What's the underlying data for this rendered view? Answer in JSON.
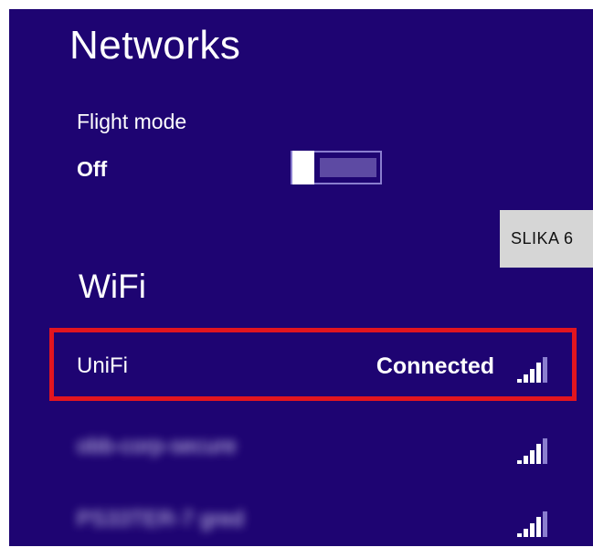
{
  "panel": {
    "title": "Networks",
    "background": "#1e0472"
  },
  "flight_mode": {
    "label": "Flight mode",
    "state": "Off"
  },
  "caption_tag": "SLIKA 6",
  "wifi": {
    "heading": "WiFi",
    "highlight_color": "#e3151f",
    "networks": [
      {
        "name": "UniFi",
        "status": "Connected",
        "signal_icon": "wifi-signal-icon",
        "signal_bars": 5
      },
      {
        "name": "obb-corp-secure",
        "status": "",
        "signal_icon": "wifi-signal-icon",
        "signal_bars": 5,
        "obscured": true
      },
      {
        "name": "PS33TER-7 gred",
        "status": "",
        "signal_icon": "wifi-signal-icon",
        "signal_bars": 5,
        "obscured": true
      }
    ]
  }
}
